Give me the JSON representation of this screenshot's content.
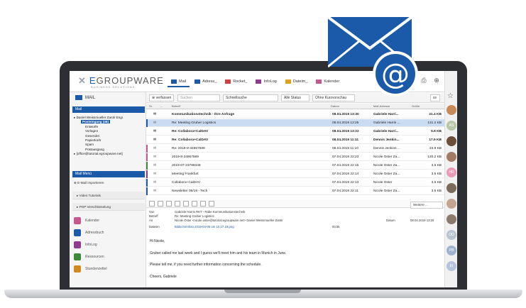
{
  "brand": {
    "logo_prefix": "E",
    "logo_rest": "GROUPWARE",
    "logo_tagline": "BUSINESS SOLUTIONS",
    "accent": "#1a5aa8"
  },
  "app_tabs": [
    {
      "label": "Mail",
      "icon": "envelope-icon",
      "active": true
    },
    {
      "label": "Adress_",
      "icon": "address-book-icon",
      "active": false
    },
    {
      "label": "Rocket_",
      "icon": "rocket-icon",
      "active": false
    },
    {
      "label": "InfoLog",
      "icon": "infolog-icon",
      "active": false
    },
    {
      "label": "Dateim_",
      "icon": "folder-icon",
      "active": false
    },
    {
      "label": "Kalender",
      "icon": "calendar-icon",
      "active": false
    }
  ],
  "sidebar": {
    "title": "MAIL",
    "mail_header": "Mail",
    "account": "Daniel Weissmueller Zantir Engi",
    "inbox": "Posteingang (46)",
    "folders": [
      "Entwürfe",
      "Vorlagen",
      "Gesendet",
      "Papierkorb",
      "Spam",
      "Postausgang"
    ],
    "office_account": "[office@tutorial.egroupware.net]",
    "menu_header": "Mail Menü",
    "import_label": "E-Mail importieren",
    "links": [
      "Video Tutorials",
      "PGP Verschlüsselung"
    ],
    "apps": [
      {
        "label": "Kalender",
        "color": "#c7588b"
      },
      {
        "label": "Adressbuch",
        "color": "#1a5aa8"
      },
      {
        "label": "InfoLog",
        "color": "#8e3d8e"
      },
      {
        "label": "Ressourcen",
        "color": "#3a8a3a"
      },
      {
        "label": "Stundenzettel",
        "color": "#d08a20"
      }
    ]
  },
  "toolbar": {
    "compose_label": "verfassen",
    "search_placeholder": "Suchen",
    "quicksearch": "Schnellsuche",
    "status_filter": "Alle Status",
    "colour_filter": "Ohne Kurzvorschau",
    "go_label": "ss"
  },
  "columns": {
    "col1": "Sr.",
    "col2": "...",
    "subject": "Betreff",
    "date": "Datum",
    "address": "Mail-Adresse",
    "size": "Größe"
  },
  "messages": [
    {
      "subject": "Kommunikationstechnik - Ihre Anfrage",
      "date": "08.04.2019 13:30",
      "from": "Gabriele Harri...",
      "size": "21.4 KB",
      "bold": true,
      "selected": false,
      "flag": ""
    },
    {
      "subject": "Re: Meeting Gruber Logistics",
      "date": "08.04.2019 13:26",
      "from": "Gabriele Harris ...",
      "size": "131.2 KB",
      "bold": false,
      "selected": true,
      "flag": "#1a5aa8"
    },
    {
      "subject": "Re: Collabora+CalDAV",
      "date": "08.04.2019 13:22",
      "from": "Gabriele Harri...",
      "size": "5.8 KB",
      "bold": true,
      "selected": false,
      "flag": ""
    },
    {
      "subject": "Re: Collabora+CalDAV",
      "date": "08.04.2019 11:11",
      "from": "Dennis Jenkin...",
      "size": "17.9 KB",
      "bold": true,
      "selected": false,
      "flag": ""
    },
    {
      "subject": "Re: 2019-8-34967589",
      "date": "08.04.2019 11:10",
      "from": "Dennis Jenkins ...",
      "size": "33.8 KB",
      "bold": false,
      "selected": false,
      "flag": "#c7588b"
    },
    {
      "subject": "2019-8-34967589",
      "date": "07.04.2019 22:23",
      "from": "Nicole Oster Za...",
      "size": "130.2 KB",
      "bold": false,
      "selected": false,
      "flag": "#c7588b"
    },
    {
      "subject": "2019-07-23789348",
      "date": "07.04.2019 22:15",
      "from": "Nicole Oster Za...",
      "size": "3.5 KB",
      "bold": false,
      "selected": false,
      "flag": "#3a8a3a"
    },
    {
      "subject": "Meeting Frankfurt",
      "date": "07.04.2019 22:14",
      "from": "Nicole Oster Za...",
      "size": "3.5 KB",
      "bold": false,
      "selected": false,
      "flag": "#8e3d8e"
    },
    {
      "subject": "Collabora+CalDAV",
      "date": "07.04.2019 22:13",
      "from": "Nicole Oster",
      "size": "3.5 KB",
      "bold": false,
      "selected": false,
      "flag": "#1a5aa8"
    },
    {
      "subject": "Newsletter 05/19 - Tech",
      "date": "07.04.2019 22:11",
      "from": "Nicole Oster Za...",
      "size": "3.5 KB",
      "bold": false,
      "selected": false,
      "flag": "#1a5aa8"
    }
  ],
  "preview": {
    "more_label": "Weitere ...",
    "from_label": "Von",
    "from": "Gabriele Harris RKT - Rabe Kommunikationstechnik",
    "subject_label": "Betreff",
    "subject": "Re: Meeting Gruber Logistics",
    "to_label": "An",
    "to": "Nicole Oster <nicole.oster@tutorial.egroupware.net>  Daniel Weissmueller Zantir",
    "date_label": "Datum",
    "date": "08.04.2019 13:26",
    "files_label": "Dateien",
    "file": "Bildschirmfoto 2019-04-05 um 10.27.19.png",
    "file_size": "93.5k",
    "body": [
      "Hi Nicole,",
      "Gruber called me last week and I guess we'll meet him and his team in Munich in June.",
      "Please tell me, if you need further information concerning the schedule.",
      "Cheers, Gabriele"
    ]
  },
  "rail": {
    "avatars": [
      {
        "initials": "",
        "color": "#c98a5a"
      },
      {
        "initials": "AS",
        "color": "#b8c7a8"
      },
      {
        "initials": "",
        "color": "#6b4f3a"
      },
      {
        "initials": "",
        "color": "#a37a66"
      },
      {
        "initials": "HR",
        "color": "#e79bb6"
      },
      {
        "initials": "",
        "color": "#7b6b5b"
      },
      {
        "initials": "",
        "color": "#c4a593"
      },
      {
        "initials": "",
        "color": "#8c7a6a"
      },
      {
        "initials": "OD",
        "color": "#b9c4cf"
      },
      {
        "initials": "PB",
        "color": "#9fb3d1"
      },
      {
        "initials": "EI",
        "color": "#b6c3dd"
      }
    ]
  }
}
